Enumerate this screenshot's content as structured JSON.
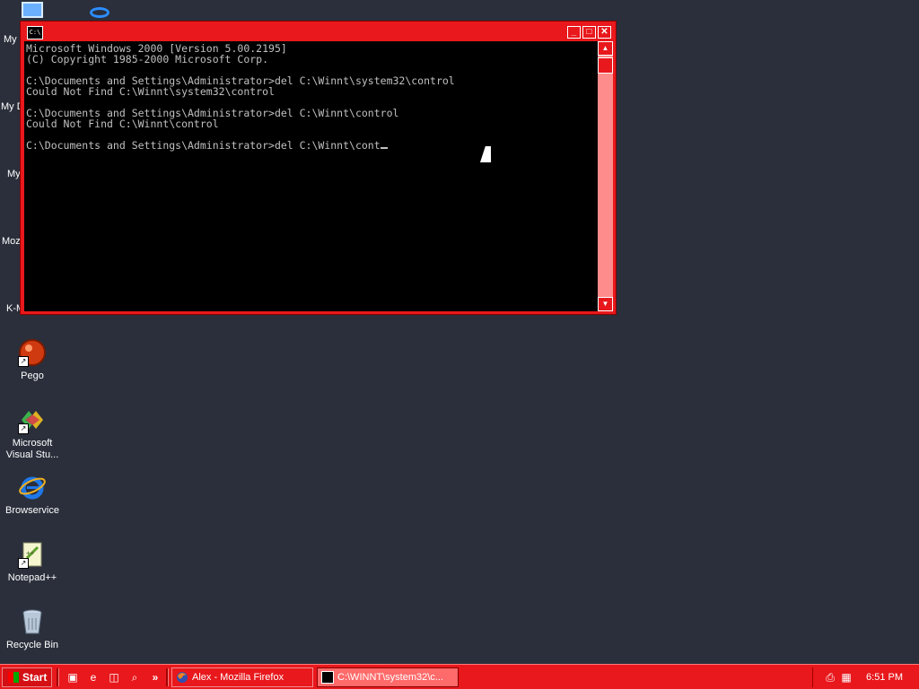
{
  "desktop": {
    "partial_labels": [
      "My",
      "My D",
      "My",
      "Moz",
      "K-M"
    ],
    "icons": [
      {
        "label": "Pego",
        "icon": "pego-icon"
      },
      {
        "label": "Microsoft\nVisual Stu...",
        "icon": "visual-studio-icon"
      },
      {
        "label": "Browservice",
        "icon": "internet-explorer-icon"
      },
      {
        "label": "Notepad++",
        "icon": "notepad-plus-plus-icon"
      },
      {
        "label": "Recycle Bin",
        "icon": "recycle-bin-icon"
      }
    ]
  },
  "console": {
    "sysmenu_label": "C:\\",
    "lines": [
      "Microsoft Windows 2000 [Version 5.00.2195]",
      "(C) Copyright 1985-2000 Microsoft Corp.",
      "",
      "C:\\Documents and Settings\\Administrator>del C:\\Winnt\\system32\\control",
      "Could Not Find C:\\Winnt\\system32\\control",
      "",
      "C:\\Documents and Settings\\Administrator>del C:\\Winnt\\control",
      "Could Not Find C:\\Winnt\\control",
      ""
    ],
    "current_input": "C:\\Documents and Settings\\Administrator>del C:\\Winnt\\cont",
    "buttons": {
      "minimize": "_",
      "maximize": "□",
      "close": "✕"
    }
  },
  "taskbar": {
    "start_label": "Start",
    "quick_launch": [
      "show-desktop-icon",
      "internet-explorer-icon",
      "network-icon",
      "search-icon"
    ],
    "overflow": "»",
    "tasks": [
      {
        "label": "Alex - Mozilla Firefox",
        "icon": "firefox-icon"
      },
      {
        "label": "C:\\WINNT\\system32\\c...",
        "icon": "console-icon"
      }
    ],
    "clock": "6:51 PM"
  },
  "colors": {
    "theme_red": "#e8181c",
    "desktop": "#2a2f3b",
    "console_bg": "#000000",
    "console_text": "#c0c0c0"
  }
}
